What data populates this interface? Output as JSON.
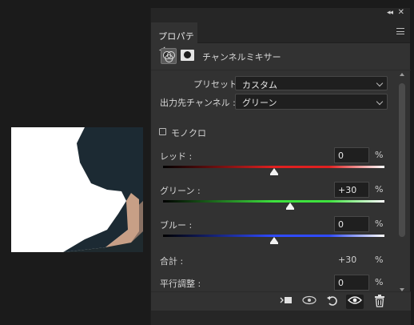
{
  "panel": {
    "tab_label": "プロパティ",
    "adjustment_title": "チャンネルミキサー"
  },
  "preset": {
    "label": "プリセット :",
    "value": "カスタム"
  },
  "output": {
    "label": "出力先チャンネル :",
    "value": "グリーン"
  },
  "monochrome": {
    "label": "モノクロ",
    "checked": false
  },
  "sliders": [
    {
      "label": "レッド :",
      "value": "0",
      "unit": "%",
      "percent": 0,
      "color": "#e02020"
    },
    {
      "label": "グリーン :",
      "value": "+30",
      "unit": "%",
      "percent": 30,
      "color": "#3ee23e"
    },
    {
      "label": "ブルー :",
      "value": "0",
      "unit": "%",
      "percent": 0,
      "color": "#2f4bff"
    }
  ],
  "total": {
    "label": "合計 :",
    "value": "+30",
    "unit": "%"
  },
  "constant": {
    "label": "平行調整 :",
    "value": "0",
    "unit": "%"
  },
  "icons": {
    "collapse": "double-chevron-left-icon",
    "close": "close-icon",
    "menu": "panel-menu-icon",
    "adjustment": "channel-mixer-icon",
    "mask": "layer-mask-icon",
    "clip": "clip-to-layer-icon",
    "view_previous": "view-previous-state-icon",
    "reset": "reset-icon",
    "visibility": "eye-icon",
    "delete": "trash-icon"
  }
}
